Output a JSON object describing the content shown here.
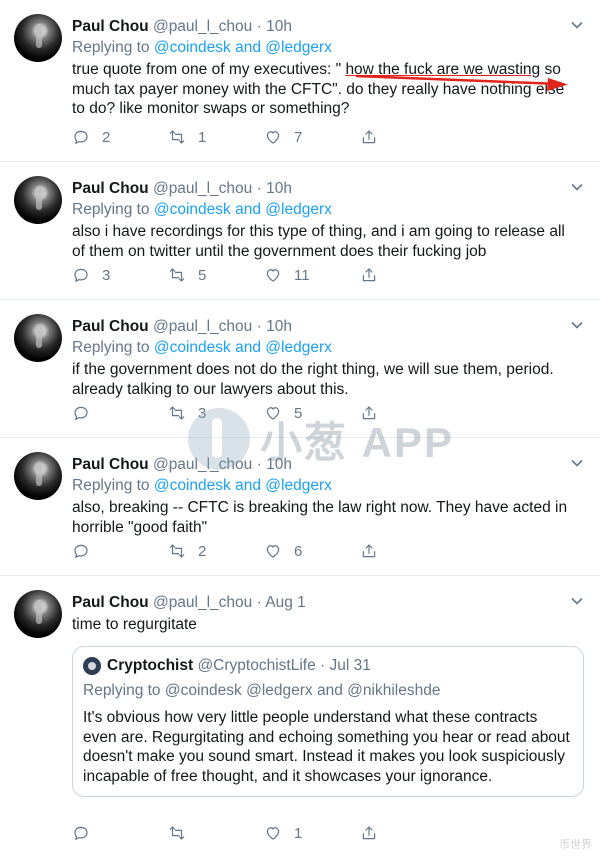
{
  "tweets": [
    {
      "name": "Paul Chou",
      "handle": "@paul_l_chou",
      "dot": "·",
      "time": "10h",
      "replying": "Replying to",
      "mention1": "@coindesk",
      "and": "and",
      "mention2": "@ledgerx",
      "text_before": "true quote from one of my executives: \" ",
      "text_underlined": "how the fuck are we wasting",
      "text_after": " so much tax payer money with the CFTC\".  do they really have nothing else to do? like monitor swaps or something?",
      "replies": "2",
      "retweets": "1",
      "likes": "7"
    },
    {
      "name": "Paul Chou",
      "handle": "@paul_l_chou",
      "dot": "·",
      "time": "10h",
      "replying": "Replying to",
      "mention1": "@coindesk",
      "and": "and",
      "mention2": "@ledgerx",
      "text": "also i have recordings for this type of thing, and i am going to release all of them on twitter until the government does their fucking job",
      "replies": "3",
      "retweets": "5",
      "likes": "11"
    },
    {
      "name": "Paul Chou",
      "handle": "@paul_l_chou",
      "dot": "·",
      "time": "10h",
      "replying": "Replying to",
      "mention1": "@coindesk",
      "and": "and",
      "mention2": "@ledgerx",
      "text": "if the government does not do the right thing, we will sue them, period. already talking to our lawyers about this.",
      "replies": "",
      "retweets": "3",
      "likes": "5"
    },
    {
      "name": "Paul Chou",
      "handle": "@paul_l_chou",
      "dot": "·",
      "time": "10h",
      "replying": "Replying to",
      "mention1": "@coindesk",
      "and": "and",
      "mention2": "@ledgerx",
      "text": "also, breaking -- CFTC is breaking the law right now. They have acted in horrible \"good faith\"",
      "replies": "",
      "retweets": "2",
      "likes": "6"
    },
    {
      "name": "Paul Chou",
      "handle": "@paul_l_chou",
      "dot": "·",
      "time": "Aug 1",
      "text": "time to regurgitate",
      "replies": "",
      "retweets": "",
      "likes": "1",
      "quote": {
        "name": "Cryptochist",
        "handle": "@CryptochistLife",
        "dot": "·",
        "time": "Jul 31",
        "replying": "Replying to",
        "mention1": "@coindesk",
        "mention2": "@ledgerx",
        "and": "and",
        "mention3": "@nikhileshde",
        "text": "It's obvious how very little people understand what these contracts even are. Regurgitating and echoing something you hear or read about doesn't make you sound smart. Instead it makes you look suspiciously incapable of free thought, and it showcases your ignorance."
      }
    }
  ],
  "watermark": {
    "text": "小葱 APP"
  },
  "corner_watermark": "币世界",
  "annotation_color": "#e0241c",
  "link_color": "#1da1f2",
  "icons": [
    "reply-icon",
    "retweet-icon",
    "like-icon",
    "share-icon",
    "chevron-down-icon"
  ]
}
